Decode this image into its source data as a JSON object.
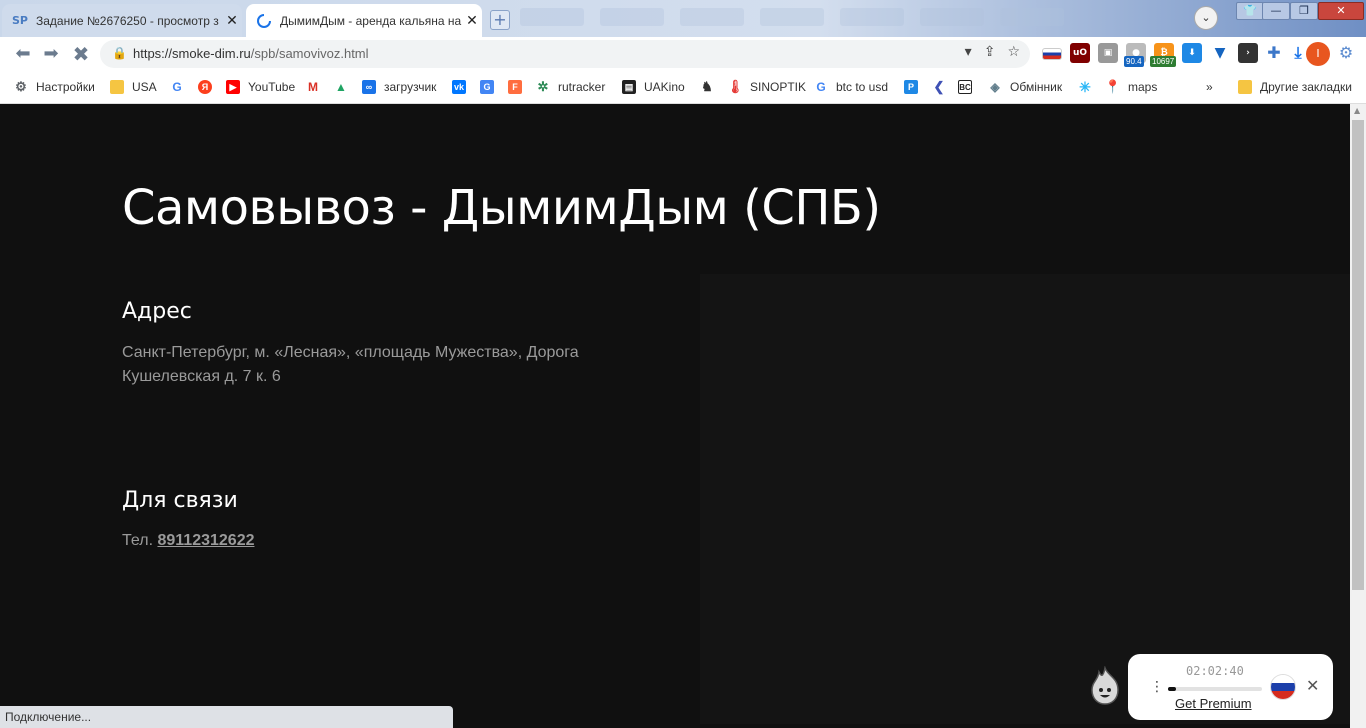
{
  "browser": {
    "tabs": [
      {
        "favicon": "SP",
        "title": "Задание №2676250 - просмотр з",
        "active": false
      },
      {
        "favicon": "loading-spinner",
        "title": "ДымимДым - аренда кальяна на",
        "active": true
      }
    ],
    "url_host": "https://smoke-dim.ru",
    "url_path": "/spb/samovivoz.html",
    "extension_badges": {
      "badge1": "90.4",
      "badge2": "10697"
    },
    "avatar_letter": "I",
    "bookmarks": [
      {
        "label": "Настройки",
        "icon": "gear-icon",
        "color": "#5f6368"
      },
      {
        "label": "USA",
        "icon": "folder-icon",
        "color": "#f5c542"
      },
      {
        "label": "",
        "icon": "google-icon",
        "color": "#4285f4"
      },
      {
        "label": "",
        "icon": "yandex-icon",
        "color": "#fc3f1d"
      },
      {
        "label": "YouTube",
        "icon": "youtube-icon",
        "color": "#ff0000"
      },
      {
        "label": "",
        "icon": "gmail-icon",
        "color": "#d93025"
      },
      {
        "label": "",
        "icon": "drive-icon",
        "color": "#1fa463"
      },
      {
        "label": "загрузчик",
        "icon": "infinity-icon",
        "color": "#1a73e8"
      },
      {
        "label": "",
        "icon": "vk-icon",
        "color": "#0077ff"
      },
      {
        "label": "",
        "icon": "translate-icon",
        "color": "#4285f4"
      },
      {
        "label": "",
        "icon": "f-icon",
        "color": "#ff6d3f"
      },
      {
        "label": "rutracker",
        "icon": "rutracker-icon",
        "color": "#2e8b57"
      },
      {
        "label": "UAKino",
        "icon": "uakino-icon",
        "color": "#222"
      },
      {
        "label": "",
        "icon": "chess-icon",
        "color": "#333"
      },
      {
        "label": "SINOPTIK",
        "icon": "thermometer-icon",
        "color": "#e53935"
      },
      {
        "label": "btc to usd",
        "icon": "google-icon",
        "color": "#4285f4"
      },
      {
        "label": "",
        "icon": "p-icon",
        "color": "#1e88e5"
      },
      {
        "label": "",
        "icon": "arrow-icon",
        "color": "#3f51b5"
      },
      {
        "label": "",
        "icon": "bc-icon",
        "color": "#222"
      },
      {
        "label": "Обмінник",
        "icon": "diamond-icon",
        "color": "#607d8b"
      },
      {
        "label": "",
        "icon": "star-icon",
        "color": "#29b6f6"
      },
      {
        "label": "maps",
        "icon": "maps-icon",
        "color": "#34a853"
      }
    ],
    "more_label": "»",
    "other_bookmarks_label": "Другие закладки",
    "status_text": "Подключение..."
  },
  "page": {
    "title": "Самовывоз - ДымимДым (СПБ)",
    "address_heading": "Адрес",
    "address_line1": "Санкт-Петербург, м. «Лесная», «площадь Мужества», Дорога",
    "address_line2": "Кушелевская д. 7 к. 6",
    "contact_heading": "Для связи",
    "phone_prefix": "Тел.",
    "phone_number": "89112312622"
  },
  "widget": {
    "time": "02:02:40",
    "progress": 0.08,
    "premium_label": "Get Premium",
    "flag": [
      "#ffffff",
      "#1c3faa",
      "#d52b1e"
    ]
  }
}
